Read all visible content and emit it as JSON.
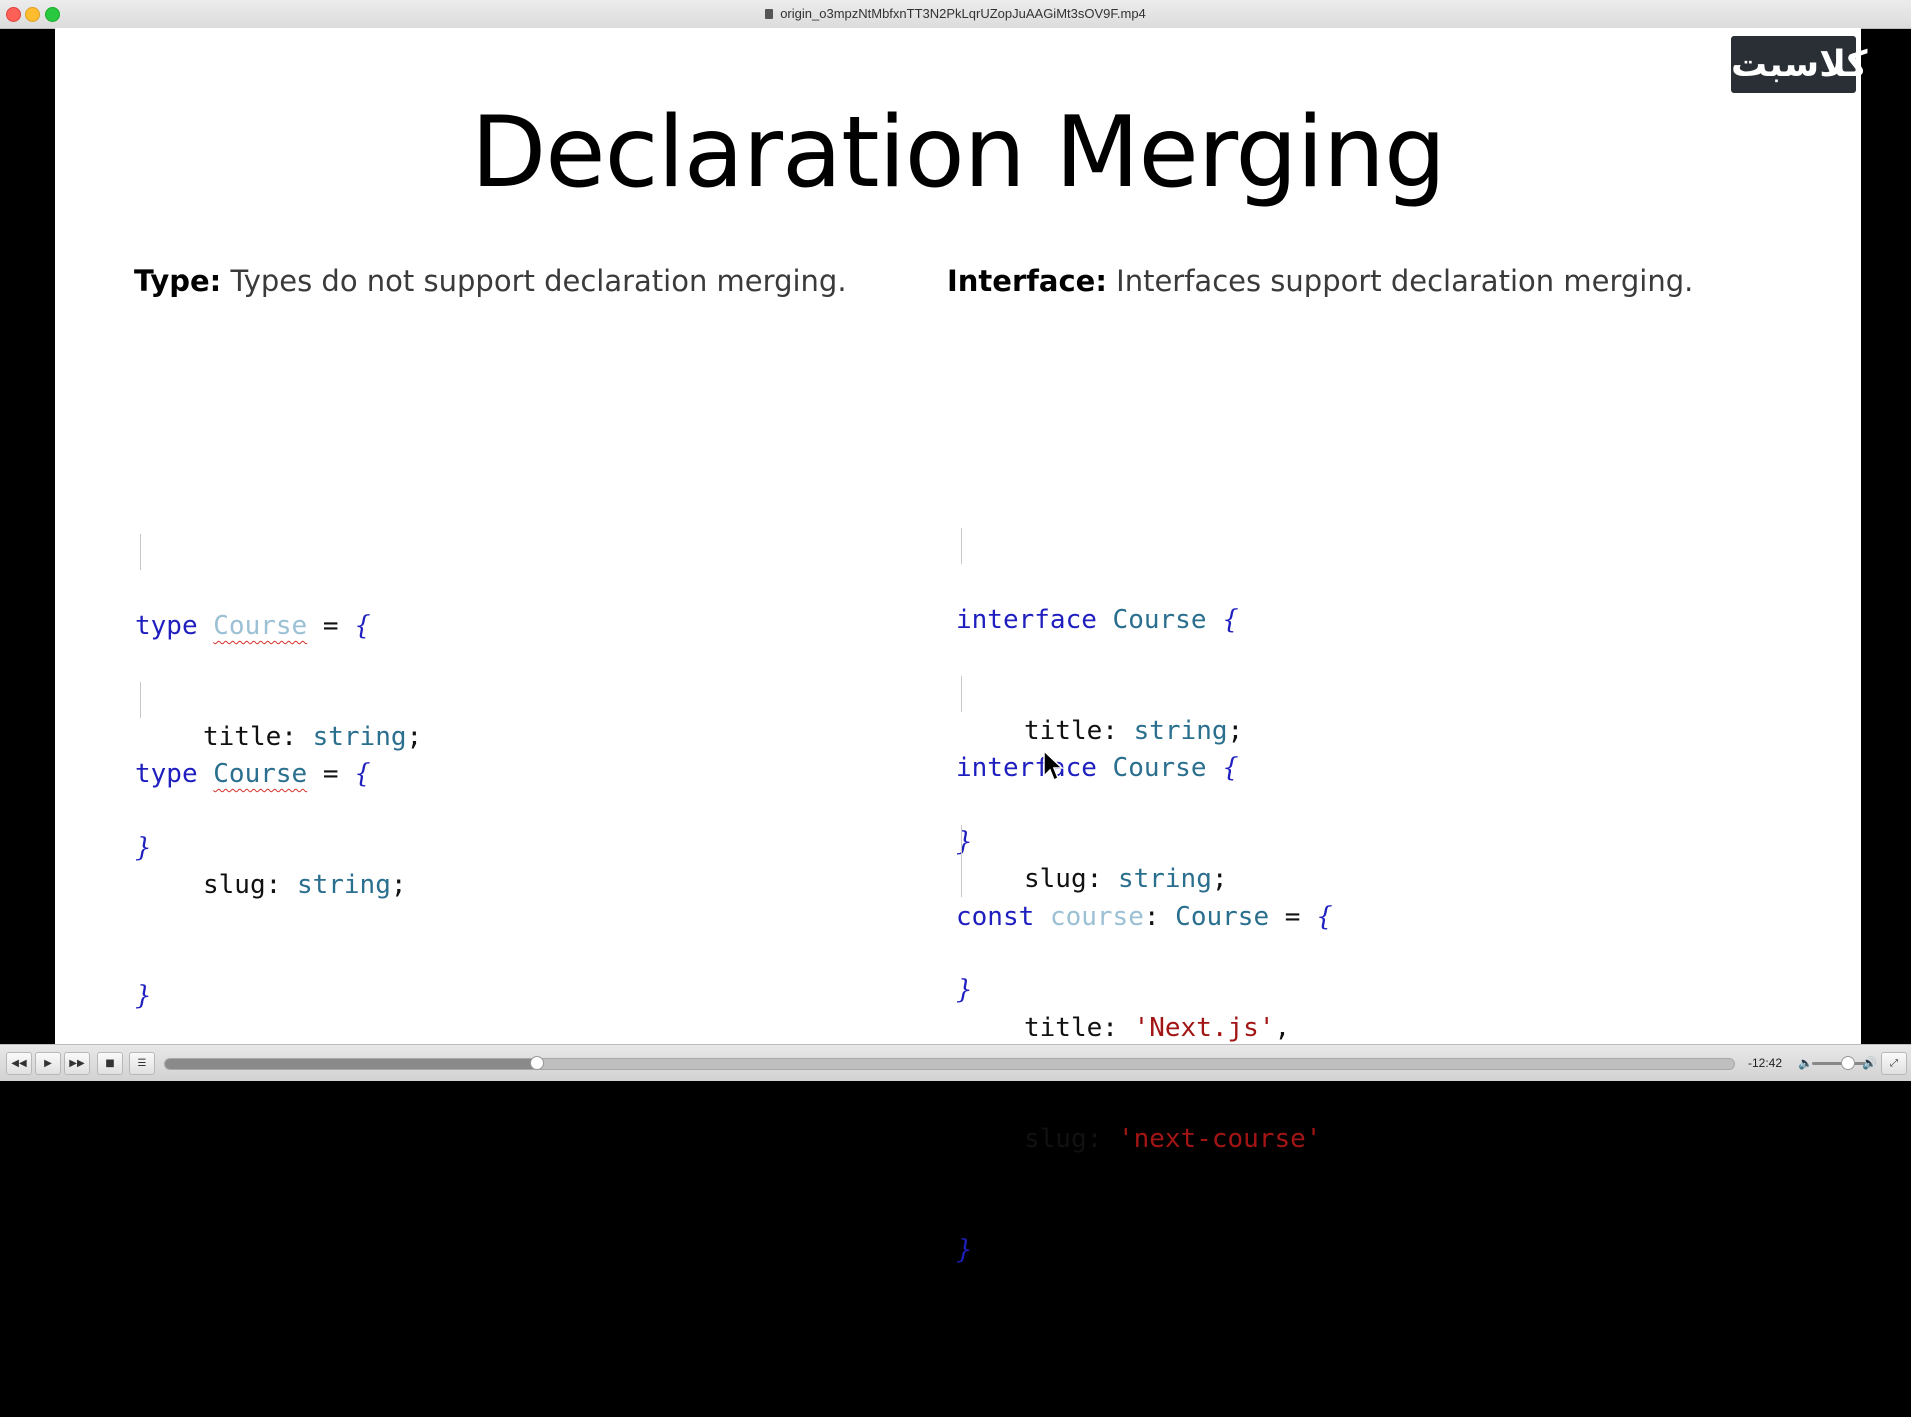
{
  "window": {
    "title": "origin_o3mpzNtMbfxnTT3N2PkLqrUZopJuAAGiMt3sOV9F.mp4"
  },
  "slide": {
    "logo_text": "کلاسبت",
    "title": "Declaration Merging",
    "left_heading_bold": "Type:",
    "left_heading_text": " Types do not support declaration merging.",
    "right_heading_bold": "Interface:",
    "right_heading_text": " Interfaces support declaration merging.",
    "left_code": {
      "block1": {
        "kw": "type",
        "name": "Course",
        "eq": " = ",
        "open": "{",
        "prop": "title",
        "colon": ": ",
        "ptype": "string",
        "semi": ";",
        "close": "}"
      },
      "block2": {
        "kw": "type",
        "name": "Course",
        "eq": " = ",
        "open": "{",
        "prop": "slug",
        "colon": ": ",
        "ptype": "string",
        "semi": ";",
        "close": "}"
      }
    },
    "right_code": {
      "block1": {
        "kw": "interface",
        "name": "Course",
        "open": "{",
        "prop": "title",
        "colon": ": ",
        "ptype": "string",
        "semi": ";",
        "close": "}"
      },
      "block2": {
        "kw": "interface",
        "name": "Course",
        "open": "{",
        "prop": "slug",
        "colon": ": ",
        "ptype": "string",
        "semi": ";",
        "close": "}"
      },
      "block3": {
        "kw": "const",
        "var": "course",
        "colon": ": ",
        "tname": "Course",
        "eq": " = ",
        "open": "{",
        "prop1": "title",
        "val1": "'Next.js'",
        "comma": ",",
        "prop2": "slug",
        "val2": "'next-course'",
        "close": "}"
      }
    }
  },
  "player": {
    "time_remaining": "-12:42",
    "progress": 0.237,
    "volume": 0.5,
    "buttons": {
      "rewind": "◀◀",
      "play": "▶",
      "forward": "▶▶",
      "stop": "■",
      "chapters": "☰",
      "fullscreen": "⤢"
    }
  }
}
